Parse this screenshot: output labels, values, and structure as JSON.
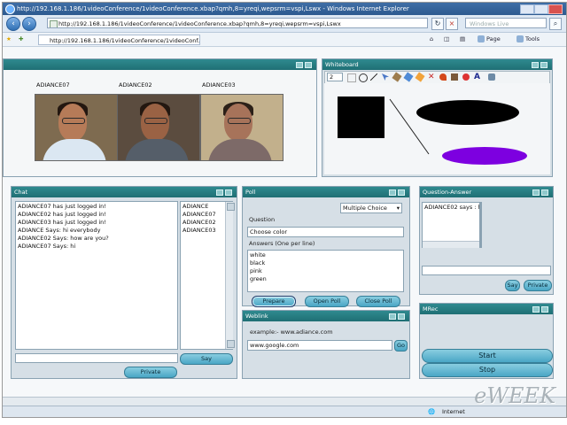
{
  "browser": {
    "title": "http://192.168.1.186/1videoConference/1videoConference.xbap?qmh,8=yreqi,wepsrm=vspi,Lswx - Windows Internet Explorer",
    "address": "http://192.168.1.186/1videoConference/1videoConference.xbap?qmh,8=yreqi,wepsrm=vspi,Lswx",
    "search_placeholder": "Windows Live",
    "tab_label": "http://192.168.1.186/1videoConference/1videoConf...",
    "toolbar": {
      "page": "Page",
      "tools": "Tools"
    },
    "status_zone": "Internet"
  },
  "video": {
    "participants": [
      {
        "name": "ADIANCE07"
      },
      {
        "name": "ADIANCE02"
      },
      {
        "name": "ADIANCE03"
      }
    ]
  },
  "whiteboard": {
    "title": "Whiteboard",
    "size_value": "2"
  },
  "chat": {
    "title": "Chat",
    "messages": [
      "ADIANCE07 has just logged in!",
      "ADIANCE02 has just logged in!",
      "ADIANCE03 has just logged in!",
      "ADIANCE Says: hi everybody",
      "ADIANCE02 Says: how are you?",
      "ADIANCE07 Says: hi"
    ],
    "users": [
      "ADIANCE",
      "ADIANCE07",
      "ADIANCE02",
      "ADIANCE03"
    ],
    "input_value": "",
    "say_label": "Say",
    "private_label": "Private"
  },
  "poll": {
    "title": "Poll",
    "type_value": "Multiple Choice",
    "question_label": "Question",
    "question_value": "Choose color",
    "answers_label": "Answers (One per line)",
    "answers": [
      "white",
      "black",
      "pink",
      "green"
    ],
    "prepare_label": "Prepare",
    "open_label": "Open Poll",
    "close_label": "Close Poll"
  },
  "qa": {
    "title": "Question-Answer",
    "entry": "ADIANCE02 says : hi",
    "input_value": "",
    "say_label": "Say",
    "private_label": "Private"
  },
  "weblink": {
    "title": "Weblink",
    "example": "example:- www.adiance.com",
    "url_value": "www.google.com",
    "go_label": "Go"
  },
  "mrec": {
    "title": "MRec",
    "start_label": "Start",
    "stop_label": "Stop"
  },
  "watermark": "eWEEK"
}
